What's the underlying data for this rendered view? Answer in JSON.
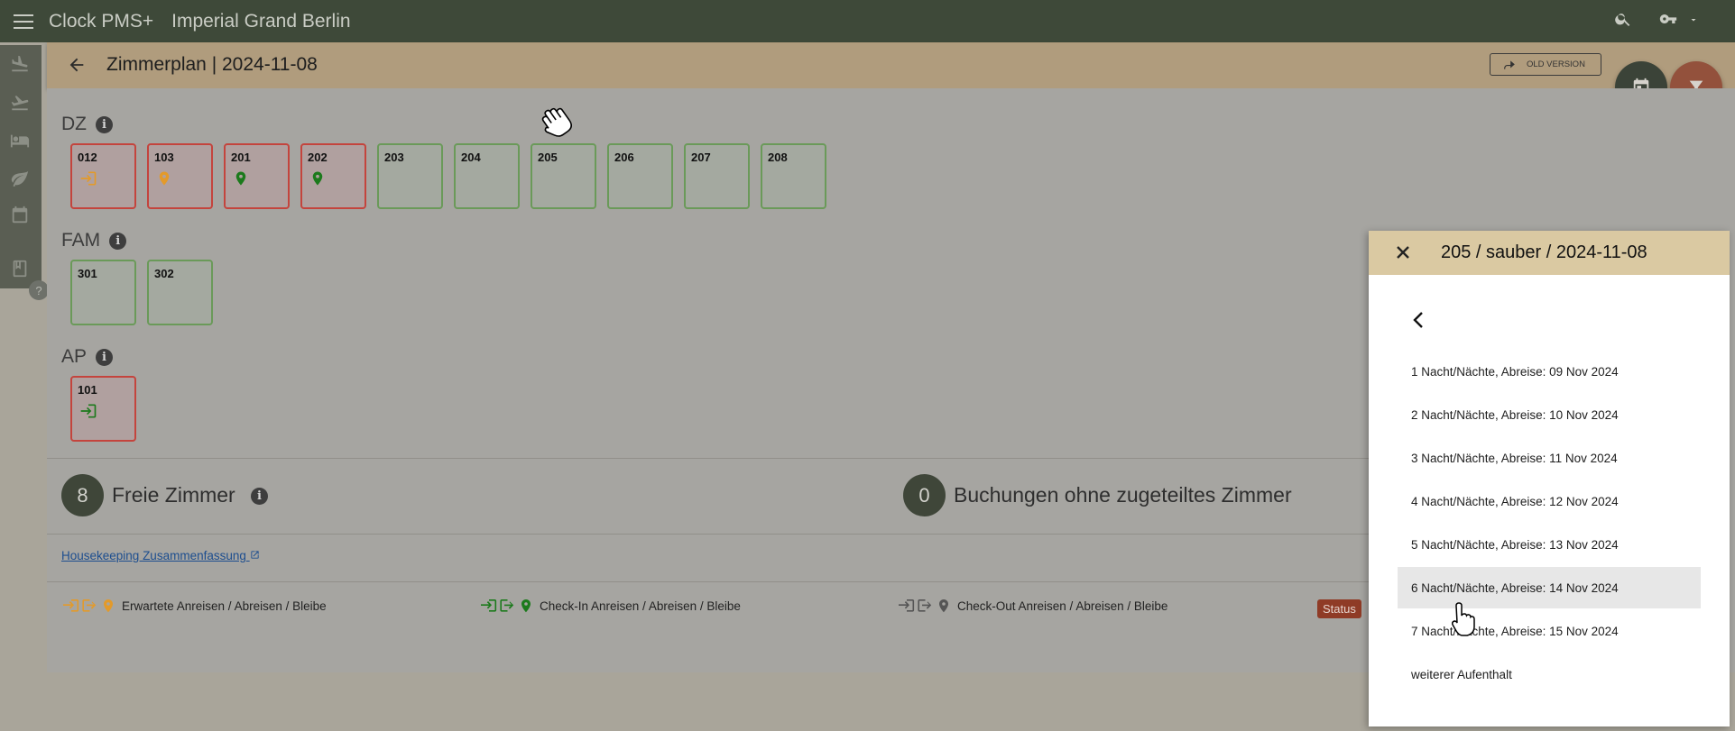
{
  "topbar": {
    "app_title": "Clock PMS+",
    "hotel_name": "Imperial Grand Berlin",
    "icons": [
      "menu-icon",
      "search-icon",
      "key-icon",
      "chevron-down-icon"
    ]
  },
  "rail": {
    "icons": [
      "plane-landing-icon",
      "plane-takeoff-icon",
      "bed-icon",
      "leaf-icon",
      "calendar-icon",
      "book-icon"
    ],
    "help": "?"
  },
  "header": {
    "title": "Zimmerplan | 2024-11-08",
    "old_version_label": "OLD VERSION"
  },
  "categories": [
    {
      "name": "DZ",
      "info": "i",
      "rooms": [
        {
          "number": "012",
          "state": "occupied",
          "icon": "arrival-icon",
          "icon_color": "#e39a2a"
        },
        {
          "number": "103",
          "state": "occupied",
          "icon": "location-pin-icon",
          "icon_color": "#e39a2a"
        },
        {
          "number": "201",
          "state": "occupied",
          "icon": "location-pin-icon",
          "icon_color": "#1c7a1c"
        },
        {
          "number": "202",
          "state": "occupied",
          "icon": "location-pin-icon",
          "icon_color": "#1c7a1c"
        },
        {
          "number": "203",
          "state": "free"
        },
        {
          "number": "204",
          "state": "free"
        },
        {
          "number": "205",
          "state": "free"
        },
        {
          "number": "206",
          "state": "free"
        },
        {
          "number": "207",
          "state": "free"
        },
        {
          "number": "208",
          "state": "free"
        }
      ]
    },
    {
      "name": "FAM",
      "info": "i",
      "rooms": [
        {
          "number": "301",
          "state": "free"
        },
        {
          "number": "302",
          "state": "free"
        }
      ]
    },
    {
      "name": "AP",
      "info": "i",
      "rooms": [
        {
          "number": "101",
          "state": "occupied",
          "icon": "arrival-icon",
          "icon_color": "#1c7a1c"
        }
      ]
    }
  ],
  "summary": {
    "free_count": "8",
    "free_label": "Freie Zimmer",
    "unassigned_count": "0",
    "unassigned_label": "Buchungen ohne zugeteiltes Zimmer",
    "info": "i"
  },
  "housekeeping_link": "Housekeeping Zusammenfassung",
  "legend": [
    {
      "label": "Erwartete Anreisen / Abreisen / Bleibe",
      "color": "#e39a2a"
    },
    {
      "label": "Check-In Anreisen / Abreisen / Bleibe",
      "color": "#1c7a1c"
    },
    {
      "label": "Check-Out Anreisen / Abreisen / Bleibe",
      "color": "#555555"
    }
  ],
  "status_badge": "Status",
  "panel": {
    "title": "205 / sauber / 2024-11-08",
    "options": [
      "1 Nacht/Nächte, Abreise: 09 Nov 2024",
      "2 Nacht/Nächte, Abreise: 10 Nov 2024",
      "3 Nacht/Nächte, Abreise: 11 Nov 2024",
      "4 Nacht/Nächte, Abreise: 12 Nov 2024",
      "5 Nacht/Nächte, Abreise: 13 Nov 2024",
      "6 Nacht/Nächte, Abreise: 14 Nov 2024",
      "7 Nacht/Nächte, Abreise: 15 Nov 2024",
      "weiterer Aufenthalt"
    ],
    "highlighted_option": 5
  }
}
